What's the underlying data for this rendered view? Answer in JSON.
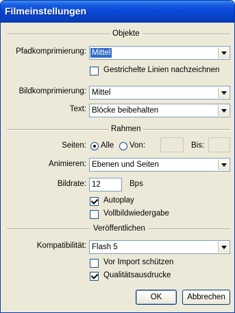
{
  "window": {
    "title": "Filmeinstellungen"
  },
  "sections": {
    "objects": "Objekte",
    "frames": "Rahmen",
    "publish": "Veröffentlichen"
  },
  "objects": {
    "path_label": "Pfadkomprimierung:",
    "path_value": "Mittel",
    "dashed_label": "Gestrichelte Linien nachzeichnen",
    "dashed_checked": false,
    "image_label": "Bildkomprimierung:",
    "image_value": "Mittel",
    "text_label": "Text:",
    "text_value": "Blöcke beibehalten"
  },
  "frames": {
    "pages_label": "Seiten:",
    "all_label": "Alle",
    "from_label": "Von:",
    "to_label": "Bis:",
    "all_selected": true,
    "from_value": "",
    "to_value": "",
    "animate_label": "Animieren:",
    "animate_value": "Ebenen und Seiten",
    "framerate_label": "Bildrate:",
    "framerate_value": "12",
    "framerate_unit": "Bps",
    "autoplay_label": "Autoplay",
    "autoplay_checked": true,
    "fullscreen_label": "Vollbildwiedergabe",
    "fullscreen_checked": false
  },
  "publish": {
    "compat_label": "Kompatibilität:",
    "compat_value": "Flash 5",
    "protect_label": "Vor Import schützen",
    "protect_checked": false,
    "quality_label": "Qualitätsausdrucke",
    "quality_checked": true
  },
  "buttons": {
    "ok": "OK",
    "cancel": "Abbrechen"
  }
}
